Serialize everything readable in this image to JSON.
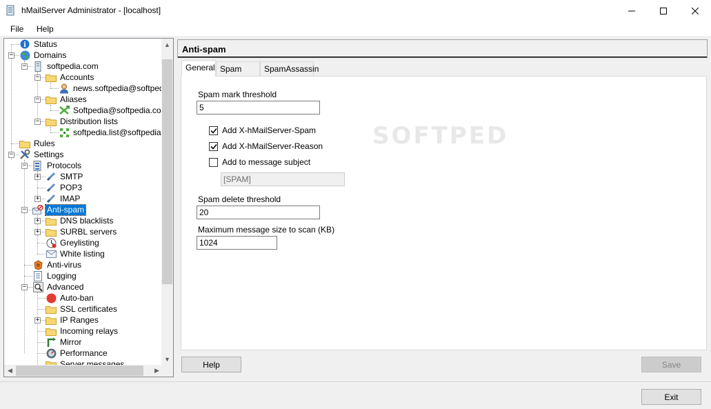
{
  "window": {
    "title": "hMailServer Administrator - [localhost]",
    "minimize_label": "—",
    "maximize_label": "☐",
    "close_label": "✕"
  },
  "menu": {
    "file": "File",
    "help": "Help"
  },
  "tree": {
    "status": "Status",
    "domains": "Domains",
    "domain": "softpedia.com",
    "accounts": "Accounts",
    "account": "news.softpedia@softpedia.c",
    "aliases": "Aliases",
    "alias": "Softpedia@softpedia.com",
    "distribution_lists": "Distribution lists",
    "list": "softpedia.list@softpedia.com",
    "rules": "Rules",
    "settings": "Settings",
    "protocols": "Protocols",
    "smtp": "SMTP",
    "pop3": "POP3",
    "imap": "IMAP",
    "antispam": "Anti-spam",
    "dns_blacklists": "DNS blacklists",
    "surbl_servers": "SURBL servers",
    "greylisting": "Greylisting",
    "white_listing": "White listing",
    "antivirus": "Anti-virus",
    "logging": "Logging",
    "advanced": "Advanced",
    "autoban": "Auto-ban",
    "ssl_certificates": "SSL certificates",
    "ip_ranges": "IP Ranges",
    "incoming_relays": "Incoming relays",
    "mirror": "Mirror",
    "performance": "Performance",
    "server_messages": "Server messages"
  },
  "panel": {
    "title": "Anti-spam",
    "tabs": [
      "General",
      "Spam tests",
      "SpamAssassin"
    ],
    "spam_mark_threshold_label": "Spam mark threshold",
    "spam_mark_threshold_value": "5",
    "add_x_spam_label": "Add X-hMailServer-Spam",
    "add_x_spam_checked": true,
    "add_x_reason_label": "Add X-hMailServer-Reason",
    "add_x_reason_checked": true,
    "add_subject_label": "Add to message subject",
    "add_subject_checked": false,
    "subject_text_value": "[SPAM]",
    "spam_delete_threshold_label": "Spam delete threshold",
    "spam_delete_threshold_value": "20",
    "max_size_label": "Maximum message size to scan (KB)",
    "max_size_value": "1024"
  },
  "buttons": {
    "help": "Help",
    "save": "Save",
    "exit": "Exit"
  },
  "watermark": "SOFTPEDIA"
}
